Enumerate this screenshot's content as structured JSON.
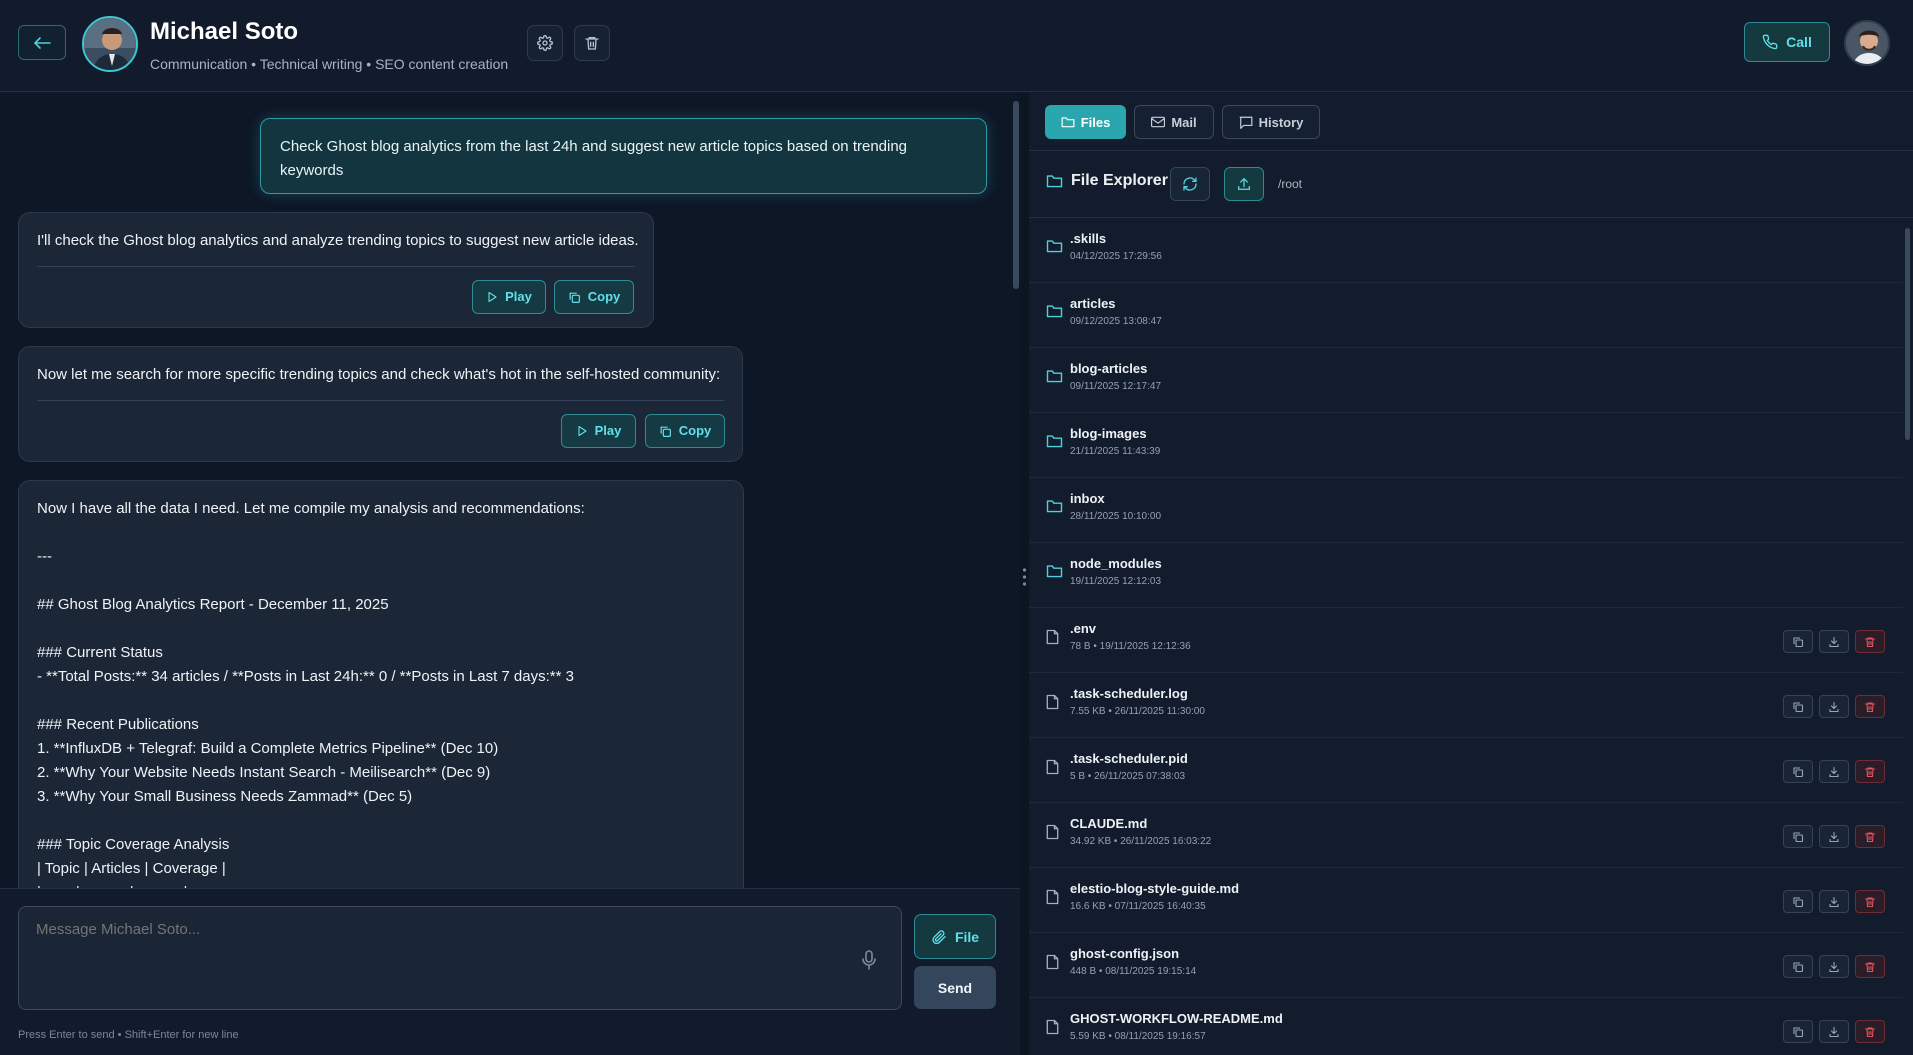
{
  "header": {
    "name": "Michael Soto",
    "subtitle": "Communication • Technical writing • SEO content creation",
    "call_label": "Call"
  },
  "chat": {
    "user_message": "Check Ghost blog analytics from the last 24h and suggest new article topics based on trending keywords",
    "bot_messages": [
      {
        "text": "I'll check the Ghost blog analytics and analyze trending topics to suggest new article ideas.",
        "play_label": "Play",
        "copy_label": "Copy"
      },
      {
        "text": "Now let me search for more specific trending topics and check what's hot in the self-hosted community:",
        "play_label": "Play",
        "copy_label": "Copy"
      }
    ],
    "report_lines": [
      "Now I have all the data I need. Let me compile my analysis and recommendations:",
      "",
      "---",
      "",
      "## Ghost Blog Analytics Report - December 11, 2025",
      "",
      "### Current Status",
      "- **Total Posts:** 34 articles / **Posts in Last 24h:** 0 / **Posts in Last 7 days:** 3",
      "",
      "### Recent Publications",
      "1. **InfluxDB + Telegraf: Build a Complete Metrics Pipeline** (Dec 10)",
      "2. **Why Your Website Needs Instant Search - Meilisearch** (Dec 9)",
      "3. **Why Your Small Business Needs Zammad** (Dec 5)",
      "",
      "### Topic Coverage Analysis",
      "| Topic | Articles | Coverage |",
      "|-------|----------|----------|"
    ]
  },
  "composer": {
    "placeholder": "Message Michael Soto...",
    "file_label": "File",
    "send_label": "Send",
    "hint": "Press Enter to send • Shift+Enter for new line"
  },
  "panel": {
    "tabs": [
      {
        "label": "Files",
        "icon": "folder-icon",
        "active": true
      },
      {
        "label": "Mail",
        "icon": "mail-icon",
        "active": false
      },
      {
        "label": "History",
        "icon": "chat-icon",
        "active": false
      }
    ],
    "explorer_title": "File Explorer",
    "path": "/root",
    "folders": [
      {
        "name": ".skills",
        "date": "04/12/2025 17:29:56"
      },
      {
        "name": "articles",
        "date": "09/12/2025 13:08:47"
      },
      {
        "name": "blog-articles",
        "date": "09/11/2025 12:17:47"
      },
      {
        "name": "blog-images",
        "date": "21/11/2025 11:43:39"
      },
      {
        "name": "inbox",
        "date": "28/11/2025 10:10:00"
      },
      {
        "name": "node_modules",
        "date": "19/11/2025 12:12:03"
      }
    ],
    "files": [
      {
        "name": ".env",
        "meta": "78 B • 19/11/2025 12:12:36"
      },
      {
        "name": ".task-scheduler.log",
        "meta": "7.55 KB • 26/11/2025 11:30:00"
      },
      {
        "name": ".task-scheduler.pid",
        "meta": "5 B • 26/11/2025 07:38:03"
      },
      {
        "name": "CLAUDE.md",
        "meta": "34.92 KB • 26/11/2025 16:03:22"
      },
      {
        "name": "elestio-blog-style-guide.md",
        "meta": "16.6 KB • 07/11/2025 16:40:35"
      },
      {
        "name": "ghost-config.json",
        "meta": "448 B • 08/11/2025 19:15:14"
      },
      {
        "name": "GHOST-WORKFLOW-README.md",
        "meta": "5.59 KB • 08/11/2025 19:16:57"
      }
    ]
  },
  "colors": {
    "accent": "#3fc7d2",
    "background": "#0f1a2a",
    "danger": "#e0555f"
  }
}
